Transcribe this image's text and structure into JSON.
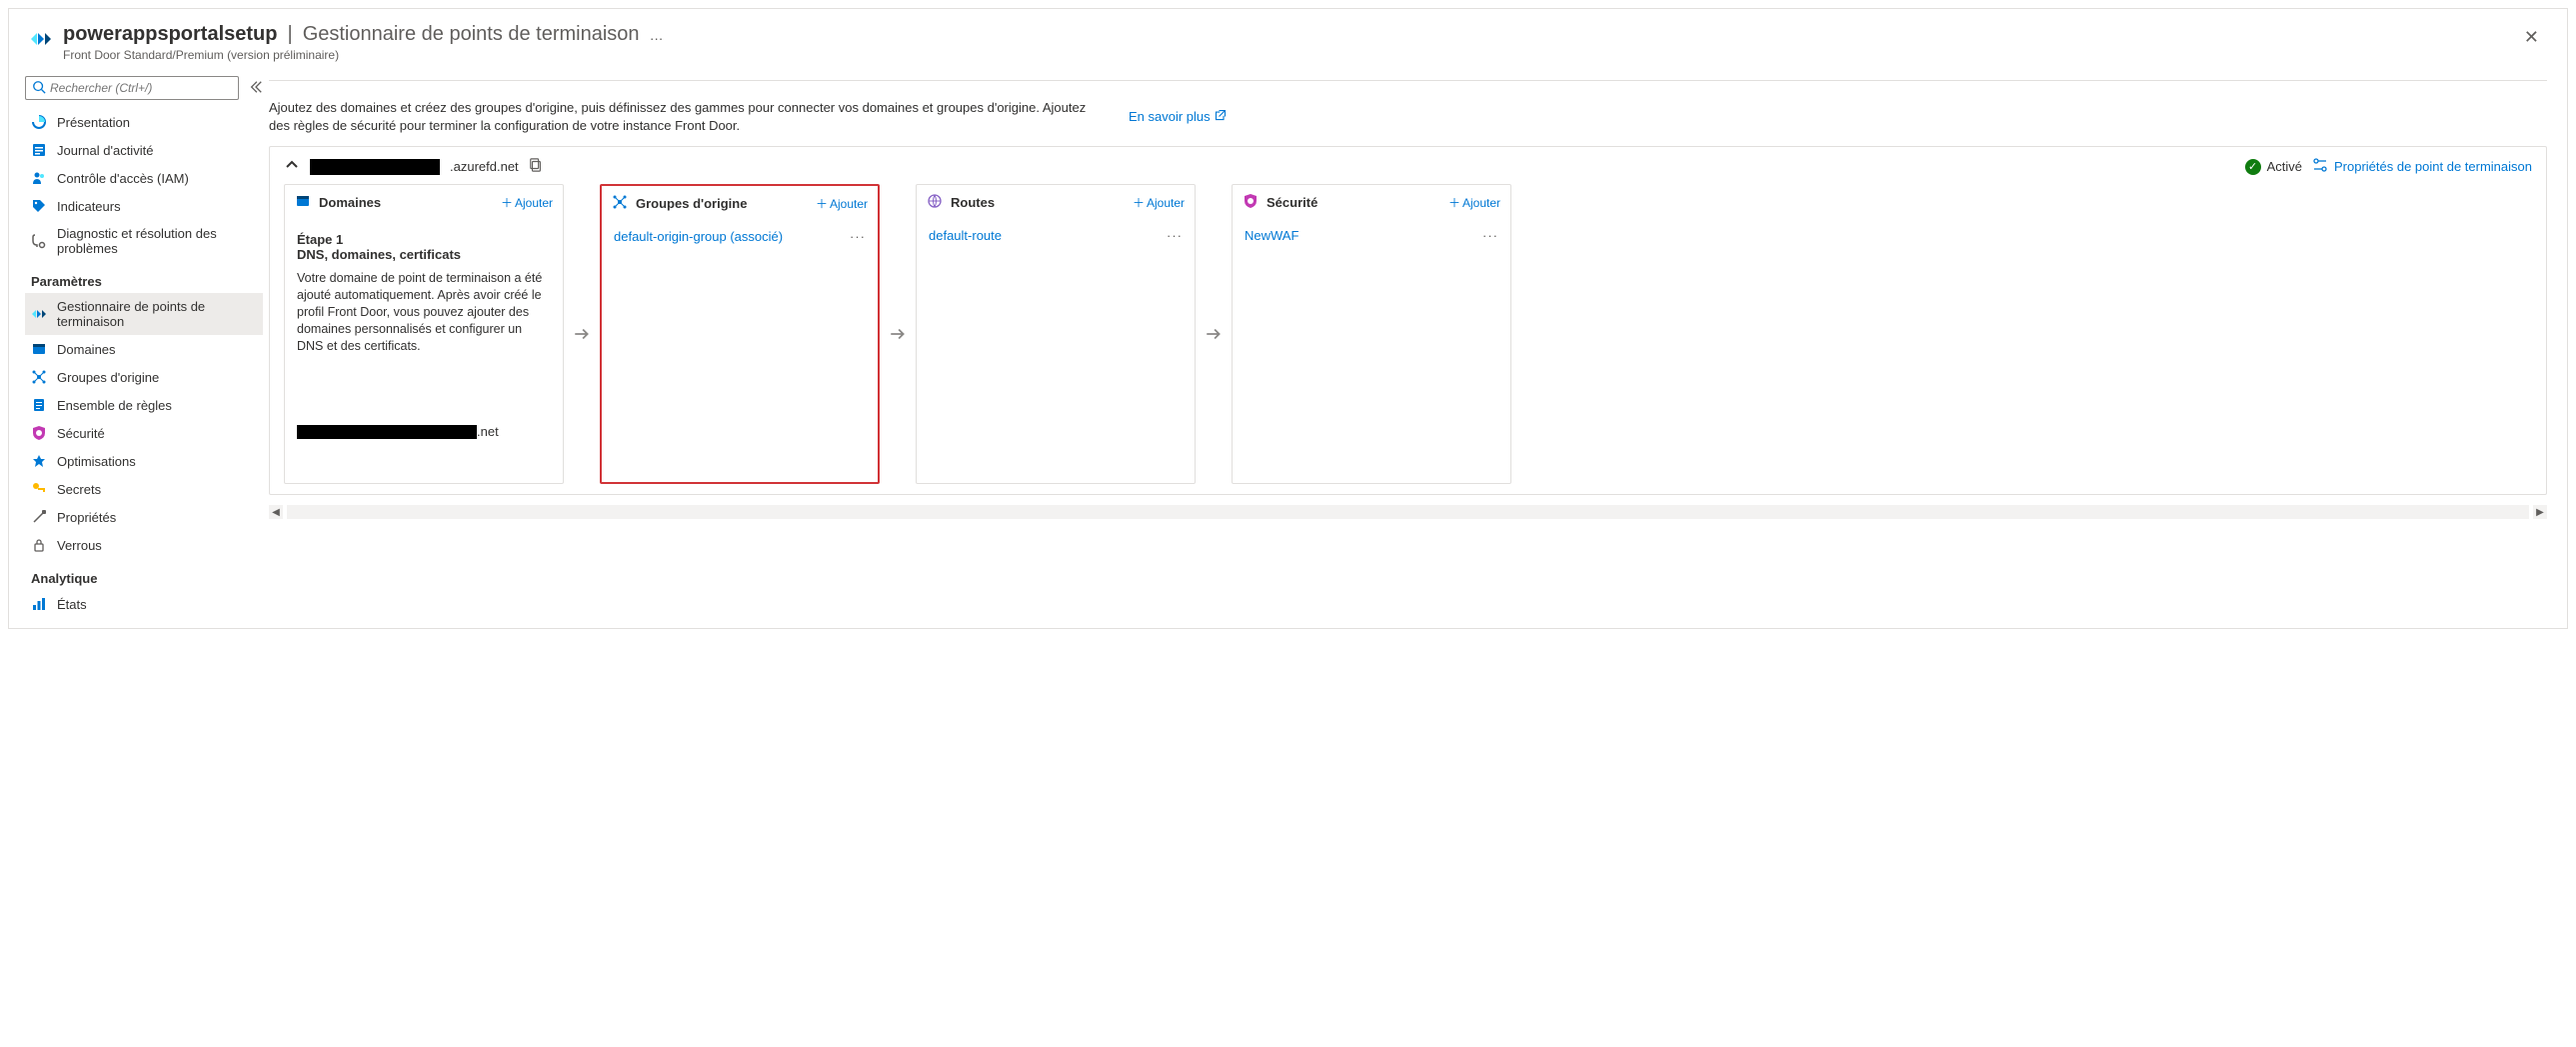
{
  "header": {
    "resource_name": "powerappsportalsetup",
    "section": "Gestionnaire de points de terminaison",
    "subtitle": "Front Door Standard/Premium (version préliminaire)"
  },
  "sidebar": {
    "search_placeholder": "Rechercher (Ctrl+/)",
    "items_top": [
      {
        "label": "Présentation"
      },
      {
        "label": "Journal d'activité"
      },
      {
        "label": "Contrôle d'accès (IAM)"
      },
      {
        "label": "Indicateurs"
      },
      {
        "label": "Diagnostic et résolution des problèmes"
      }
    ],
    "group_settings": "Paramètres",
    "items_settings": [
      {
        "label": "Gestionnaire de points de terminaison",
        "selected": true
      },
      {
        "label": "Domaines"
      },
      {
        "label": "Groupes d'origine"
      },
      {
        "label": "Ensemble de règles"
      },
      {
        "label": "Sécurité"
      },
      {
        "label": "Optimisations"
      },
      {
        "label": "Secrets"
      },
      {
        "label": "Propriétés"
      },
      {
        "label": "Verrous"
      }
    ],
    "group_analytique": "Analytique",
    "items_analytique": [
      {
        "label": "États"
      }
    ]
  },
  "main": {
    "intro": "Ajoutez des domaines et créez des groupes d'origine, puis définissez des gammes pour connecter vos domaines et groupes d'origine. Ajoutez des règles de sécurité pour terminer la configuration de votre instance Front Door.",
    "learn_more": "En savoir plus",
    "endpoint": {
      "domain_suffix": ".azurefd.net",
      "status_label": "Activé",
      "props_link": "Propriétés de point de terminaison"
    },
    "add_label": "Ajouter",
    "cards": {
      "domains": {
        "title": "Domaines",
        "step_label": "Étape 1",
        "step_title": "DNS, domaines, certificats",
        "step_desc": "Votre domaine de point de terminaison a été ajouté automatiquement. Après avoir créé le profil Front Door, vous pouvez ajouter des domaines personnalisés et configurer un DNS et des certificats.",
        "domain_suffix": ".net"
      },
      "origin_groups": {
        "title": "Groupes d'origine",
        "item": "default-origin-group (associé)"
      },
      "routes": {
        "title": "Routes",
        "item": "default-route"
      },
      "security": {
        "title": "Sécurité",
        "item": "NewWAF"
      }
    }
  }
}
